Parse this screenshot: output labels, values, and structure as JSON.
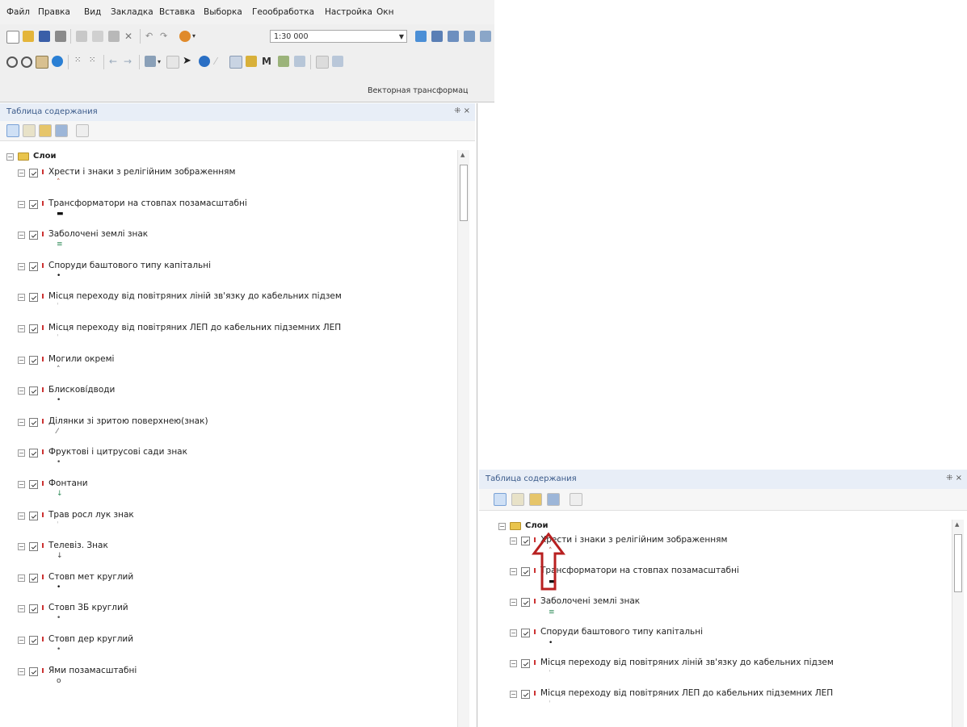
{
  "menu": [
    "Файл",
    "Правка",
    "Вид",
    "Закладка",
    "Вставка",
    "Выборка",
    "Геообработка",
    "Настройка",
    "Окн"
  ],
  "toolbar": {
    "scale_value": "1:30 000",
    "vector_transform_label": "Векторная трансформац"
  },
  "toc": {
    "title": "Таблица содержания",
    "root_label": "Слои",
    "layers": [
      {
        "name": "Хрести і знаки з релігійним зображенням",
        "symbol": "˄",
        "symbol_color": "#b5523a"
      },
      {
        "name": "Трансформатори на стовпах  позамасштабні",
        "symbol": "▬",
        "symbol_color": "#111111"
      },
      {
        "name": "Заболочені землі знак",
        "symbol": "≡",
        "symbol_color": "#2e8b57"
      },
      {
        "name": "Споруди баштового типу капітальні",
        "symbol": "•",
        "symbol_color": "#111111"
      },
      {
        "name": "Місця переходу від повітряних ліній зв'язку до кабельних підзем",
        "symbol": "ˈ",
        "symbol_color": "#aaaaaa"
      },
      {
        "name": "Місця переходу від повітряних ЛЕП до кабельних підземних ЛЕП",
        "symbol": "ˈ",
        "symbol_color": "#aaaaaa"
      },
      {
        "name": "Могили окремі",
        "symbol": "˄",
        "symbol_color": "#555555"
      },
      {
        "name": "Блискові́дводи",
        "symbol": "•",
        "symbol_color": "#333333"
      },
      {
        "name": "Ділянки зі зритою поверхнею(знак)",
        "symbol": "⁄",
        "symbol_color": "#444444"
      },
      {
        "name": "Фруктові і цитрусові сади знак",
        "symbol": "•",
        "symbol_color": "#555555"
      },
      {
        "name": "Фонтани",
        "symbol": "↓",
        "symbol_color": "#2e8b57"
      },
      {
        "name": "Трав росл лук знак",
        "symbol": "ˈ",
        "symbol_color": "#aaaaaa"
      },
      {
        "name": "Телевіз. Знак",
        "symbol": "↓",
        "symbol_color": "#444444"
      },
      {
        "name": "Стовп мет круглий",
        "symbol": "•",
        "symbol_color": "#111111"
      },
      {
        "name": "Стовп ЗБ круглий",
        "symbol": "•",
        "symbol_color": "#555555"
      },
      {
        "name": "Стовп дер круглий",
        "symbol": "•",
        "symbol_color": "#555555"
      },
      {
        "name": "Ями позамасштабні",
        "symbol": "o",
        "symbol_color": "#333333"
      }
    ]
  },
  "toc_zoom": {
    "title": "Таблица содержания",
    "root_label": "Слои",
    "layers": [
      {
        "name": "Хрести і знаки з релігійним зображенням",
        "symbol": "˄",
        "symbol_color": "#b5523a"
      },
      {
        "name": "Трансформатори на стовпах  позамасштабні",
        "symbol": "▬",
        "symbol_color": "#111111"
      },
      {
        "name": "Заболочені землі знак",
        "symbol": "≡",
        "symbol_color": "#2e8b57"
      },
      {
        "name": "Споруди баштового типу капітальні",
        "symbol": "•",
        "symbol_color": "#111111"
      },
      {
        "name": "Місця переходу від повітряних ліній зв'язку до кабельних підзем",
        "symbol": "ˈ",
        "symbol_color": "#aaaaaa"
      },
      {
        "name": "Місця переходу від повітряних ЛЕП до кабельних підземних ЛЕП",
        "symbol": "ˈ",
        "symbol_color": "#aaaaaa"
      }
    ]
  },
  "colors": {
    "annotation_arrow": "#b82020",
    "panel_title": "#3a5a8a"
  }
}
